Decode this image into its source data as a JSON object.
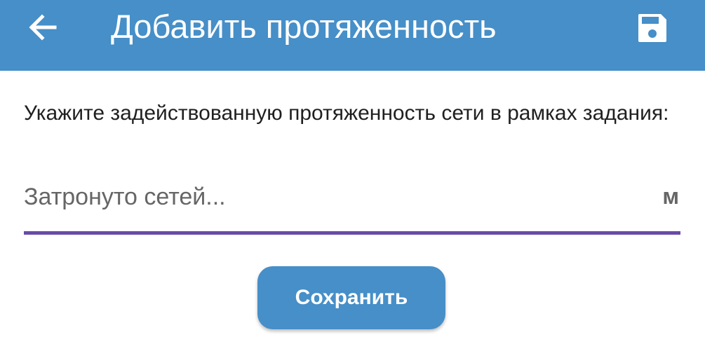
{
  "appbar": {
    "title": "Добавить протяженность",
    "back_icon": "arrow-left-icon",
    "save_icon": "floppy-disk-icon",
    "background_color": "#468fc8"
  },
  "form": {
    "prompt": "Укажите задействованную протяженность сети в рамках задания:",
    "length_input": {
      "value": "",
      "placeholder": "Затронуто сетей...",
      "unit": "м",
      "underline_color": "#6a4ba6"
    },
    "save_button_label": "Сохранить"
  }
}
